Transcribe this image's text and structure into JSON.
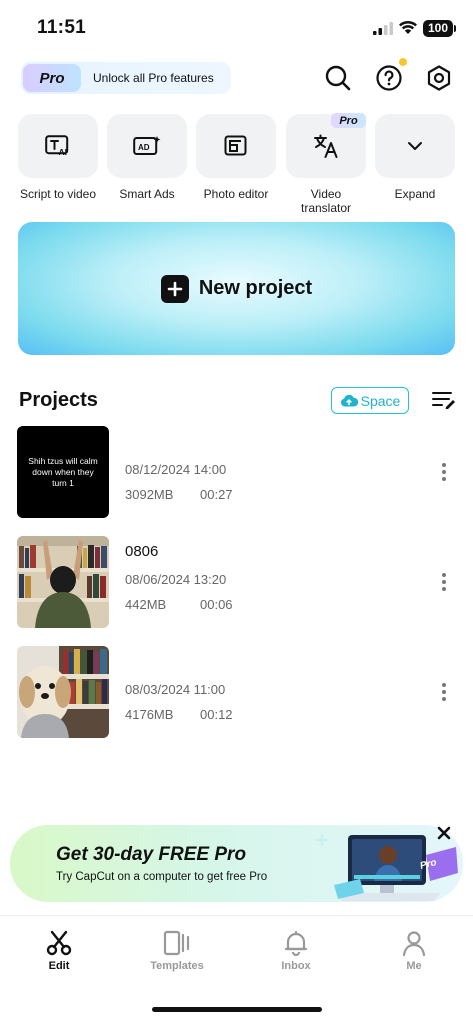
{
  "status": {
    "time": "11:51",
    "battery": "100"
  },
  "pro_banner": {
    "badge": "Pro",
    "text": "Unlock all Pro features"
  },
  "tools": [
    {
      "label": "Script to video",
      "icon": "script-ai-icon"
    },
    {
      "label": "Smart Ads",
      "icon": "ads-ai-icon"
    },
    {
      "label": "Photo editor",
      "icon": "photo-editor-icon"
    },
    {
      "label": "Video translator",
      "icon": "translate-icon",
      "badge": "Pro"
    },
    {
      "label": "Expand",
      "icon": "chevron-down-icon"
    }
  ],
  "new_project": {
    "label": "New project"
  },
  "projects": {
    "title": "Projects",
    "space_label": "Space",
    "items": [
      {
        "name": "",
        "thumb_text": "Shih tzus will calm down when they turn 1",
        "date": "08/12/2024 14:00",
        "size": "3092MB",
        "duration": "00:27"
      },
      {
        "name": "0806",
        "date": "08/06/2024 13:20",
        "size": "442MB",
        "duration": "00:06"
      },
      {
        "name": "",
        "date": "08/03/2024 11:00",
        "size": "4176MB",
        "duration": "00:12"
      }
    ]
  },
  "promo": {
    "title": "Get 30-day FREE Pro",
    "subtitle": "Try CapCut on a computer to get free Pro",
    "badge": "Pro"
  },
  "nav": {
    "edit": "Edit",
    "templates": "Templates",
    "inbox": "Inbox",
    "me": "Me"
  },
  "colors": {
    "accent": "#27c0d9",
    "notification_dot": "#f7c72f"
  }
}
